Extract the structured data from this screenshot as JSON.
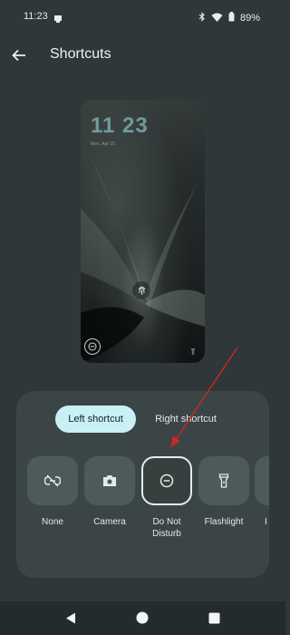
{
  "status": {
    "time": "11:23",
    "battery": "89%",
    "icons": [
      "notification-icon",
      "bluetooth-icon",
      "wifi-icon",
      "battery-icon"
    ]
  },
  "app_bar": {
    "title": "Shortcuts",
    "back_icon": "arrow-back-icon"
  },
  "preview": {
    "time": "11 23",
    "date": "Mon, Apr 15",
    "left_shortcut_icon": "do-not-disturb-icon",
    "right_shortcut_icon": "flashlight-icon",
    "fingerprint_icon": "fingerprint-icon"
  },
  "tabs": {
    "left": "Left shortcut",
    "right": "Right shortcut",
    "selected": "left"
  },
  "shortcuts": [
    {
      "label": "None",
      "icon": "link-off-icon",
      "selected": false
    },
    {
      "label": "Camera",
      "icon": "camera-icon",
      "selected": false
    },
    {
      "label": "Do Not Disturb",
      "icon": "do-not-disturb-icon",
      "selected": true
    },
    {
      "label": "Flashlight",
      "icon": "flashlight-icon",
      "selected": false
    },
    {
      "label": "I",
      "icon": "unknown-icon",
      "selected": false
    }
  ],
  "nav": [
    "back-triangle-icon",
    "home-circle-icon",
    "recents-square-icon"
  ],
  "colors": {
    "background": "#2f3738",
    "panel": "#3b4545",
    "tab_selected": "#c8f0f6",
    "tile": "#4d5a5a",
    "annotation_arrow": "#c62828"
  }
}
